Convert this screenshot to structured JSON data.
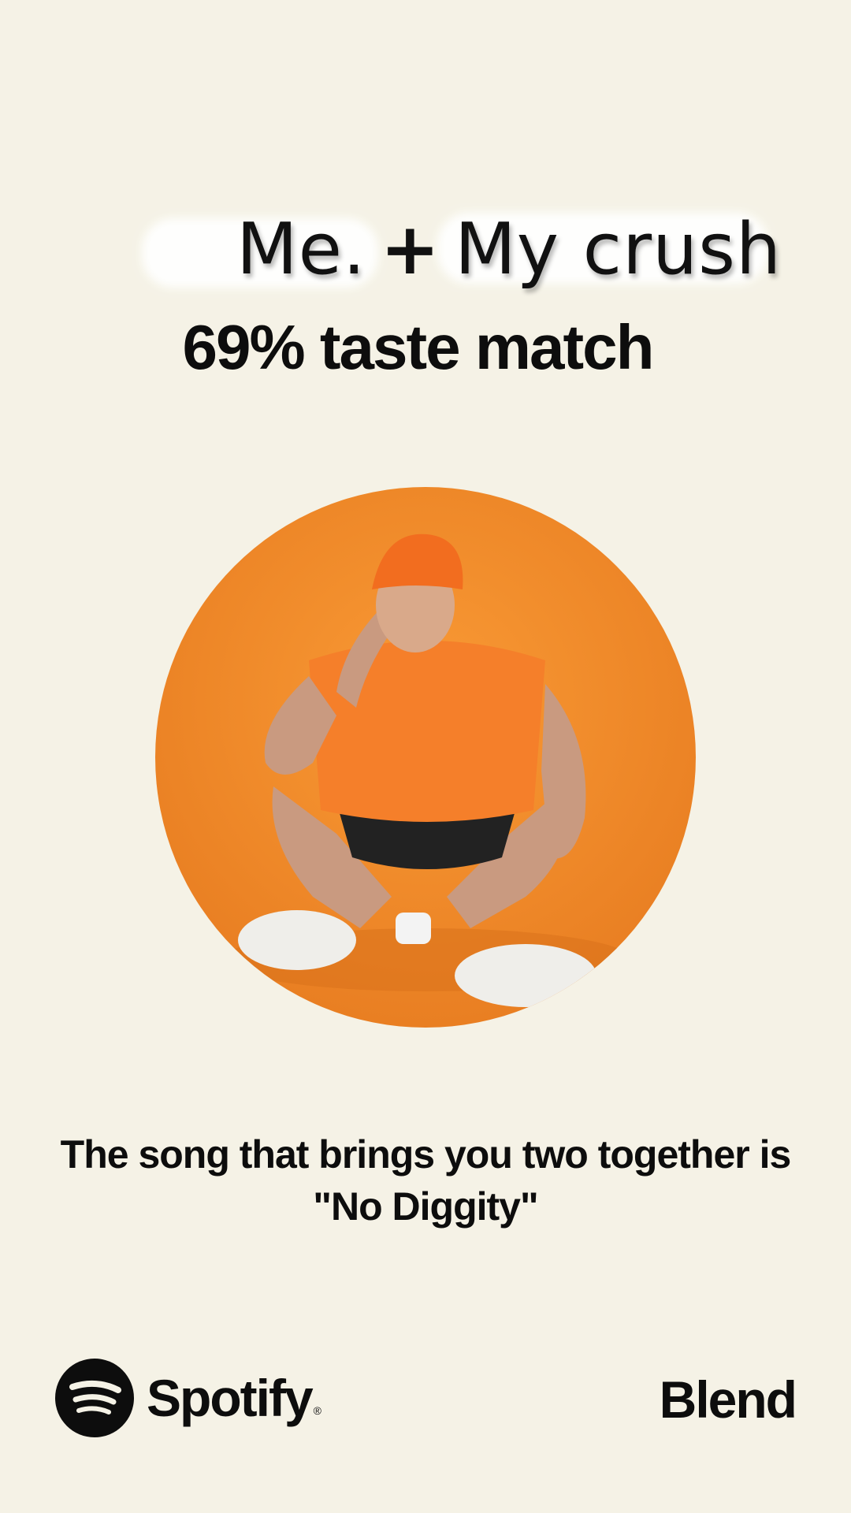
{
  "names": {
    "left": "Me.",
    "plus": "+",
    "right": "My crush"
  },
  "match_text": "69% taste match",
  "song": {
    "line1": "The song that brings you two together is",
    "line2": "\"No Diggity\""
  },
  "footer": {
    "brand": "Spotify",
    "registered": "®",
    "product": "Blend"
  },
  "colors": {
    "background": "#f5f2e6",
    "artwork_orange": "#f08a2a",
    "text": "#0d0d0d"
  },
  "icons": {
    "logo": "spotify-logo-icon"
  }
}
